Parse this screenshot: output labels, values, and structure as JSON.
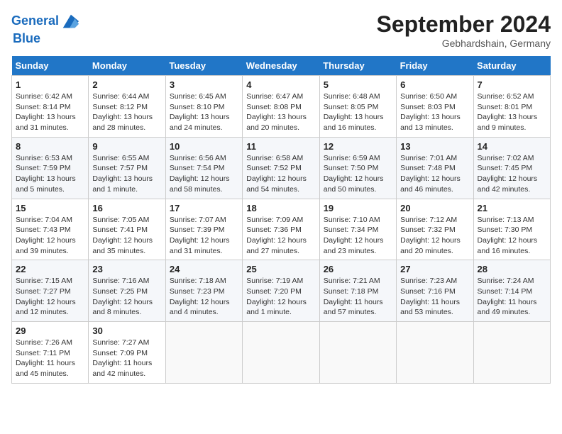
{
  "header": {
    "logo_line1": "General",
    "logo_line2": "Blue",
    "month": "September 2024",
    "location": "Gebhardshain, Germany"
  },
  "days_of_week": [
    "Sunday",
    "Monday",
    "Tuesday",
    "Wednesday",
    "Thursday",
    "Friday",
    "Saturday"
  ],
  "weeks": [
    [
      {
        "day": "1",
        "sunrise": "6:42 AM",
        "sunset": "8:14 PM",
        "daylight": "13 hours and 31 minutes."
      },
      {
        "day": "2",
        "sunrise": "6:44 AM",
        "sunset": "8:12 PM",
        "daylight": "13 hours and 28 minutes."
      },
      {
        "day": "3",
        "sunrise": "6:45 AM",
        "sunset": "8:10 PM",
        "daylight": "13 hours and 24 minutes."
      },
      {
        "day": "4",
        "sunrise": "6:47 AM",
        "sunset": "8:08 PM",
        "daylight": "13 hours and 20 minutes."
      },
      {
        "day": "5",
        "sunrise": "6:48 AM",
        "sunset": "8:05 PM",
        "daylight": "13 hours and 16 minutes."
      },
      {
        "day": "6",
        "sunrise": "6:50 AM",
        "sunset": "8:03 PM",
        "daylight": "13 hours and 13 minutes."
      },
      {
        "day": "7",
        "sunrise": "6:52 AM",
        "sunset": "8:01 PM",
        "daylight": "13 hours and 9 minutes."
      }
    ],
    [
      {
        "day": "8",
        "sunrise": "6:53 AM",
        "sunset": "7:59 PM",
        "daylight": "13 hours and 5 minutes."
      },
      {
        "day": "9",
        "sunrise": "6:55 AM",
        "sunset": "7:57 PM",
        "daylight": "13 hours and 1 minute."
      },
      {
        "day": "10",
        "sunrise": "6:56 AM",
        "sunset": "7:54 PM",
        "daylight": "12 hours and 58 minutes."
      },
      {
        "day": "11",
        "sunrise": "6:58 AM",
        "sunset": "7:52 PM",
        "daylight": "12 hours and 54 minutes."
      },
      {
        "day": "12",
        "sunrise": "6:59 AM",
        "sunset": "7:50 PM",
        "daylight": "12 hours and 50 minutes."
      },
      {
        "day": "13",
        "sunrise": "7:01 AM",
        "sunset": "7:48 PM",
        "daylight": "12 hours and 46 minutes."
      },
      {
        "day": "14",
        "sunrise": "7:02 AM",
        "sunset": "7:45 PM",
        "daylight": "12 hours and 42 minutes."
      }
    ],
    [
      {
        "day": "15",
        "sunrise": "7:04 AM",
        "sunset": "7:43 PM",
        "daylight": "12 hours and 39 minutes."
      },
      {
        "day": "16",
        "sunrise": "7:05 AM",
        "sunset": "7:41 PM",
        "daylight": "12 hours and 35 minutes."
      },
      {
        "day": "17",
        "sunrise": "7:07 AM",
        "sunset": "7:39 PM",
        "daylight": "12 hours and 31 minutes."
      },
      {
        "day": "18",
        "sunrise": "7:09 AM",
        "sunset": "7:36 PM",
        "daylight": "12 hours and 27 minutes."
      },
      {
        "day": "19",
        "sunrise": "7:10 AM",
        "sunset": "7:34 PM",
        "daylight": "12 hours and 23 minutes."
      },
      {
        "day": "20",
        "sunrise": "7:12 AM",
        "sunset": "7:32 PM",
        "daylight": "12 hours and 20 minutes."
      },
      {
        "day": "21",
        "sunrise": "7:13 AM",
        "sunset": "7:30 PM",
        "daylight": "12 hours and 16 minutes."
      }
    ],
    [
      {
        "day": "22",
        "sunrise": "7:15 AM",
        "sunset": "7:27 PM",
        "daylight": "12 hours and 12 minutes."
      },
      {
        "day": "23",
        "sunrise": "7:16 AM",
        "sunset": "7:25 PM",
        "daylight": "12 hours and 8 minutes."
      },
      {
        "day": "24",
        "sunrise": "7:18 AM",
        "sunset": "7:23 PM",
        "daylight": "12 hours and 4 minutes."
      },
      {
        "day": "25",
        "sunrise": "7:19 AM",
        "sunset": "7:20 PM",
        "daylight": "12 hours and 1 minute."
      },
      {
        "day": "26",
        "sunrise": "7:21 AM",
        "sunset": "7:18 PM",
        "daylight": "11 hours and 57 minutes."
      },
      {
        "day": "27",
        "sunrise": "7:23 AM",
        "sunset": "7:16 PM",
        "daylight": "11 hours and 53 minutes."
      },
      {
        "day": "28",
        "sunrise": "7:24 AM",
        "sunset": "7:14 PM",
        "daylight": "11 hours and 49 minutes."
      }
    ],
    [
      {
        "day": "29",
        "sunrise": "7:26 AM",
        "sunset": "7:11 PM",
        "daylight": "11 hours and 45 minutes."
      },
      {
        "day": "30",
        "sunrise": "7:27 AM",
        "sunset": "7:09 PM",
        "daylight": "11 hours and 42 minutes."
      },
      null,
      null,
      null,
      null,
      null
    ]
  ]
}
